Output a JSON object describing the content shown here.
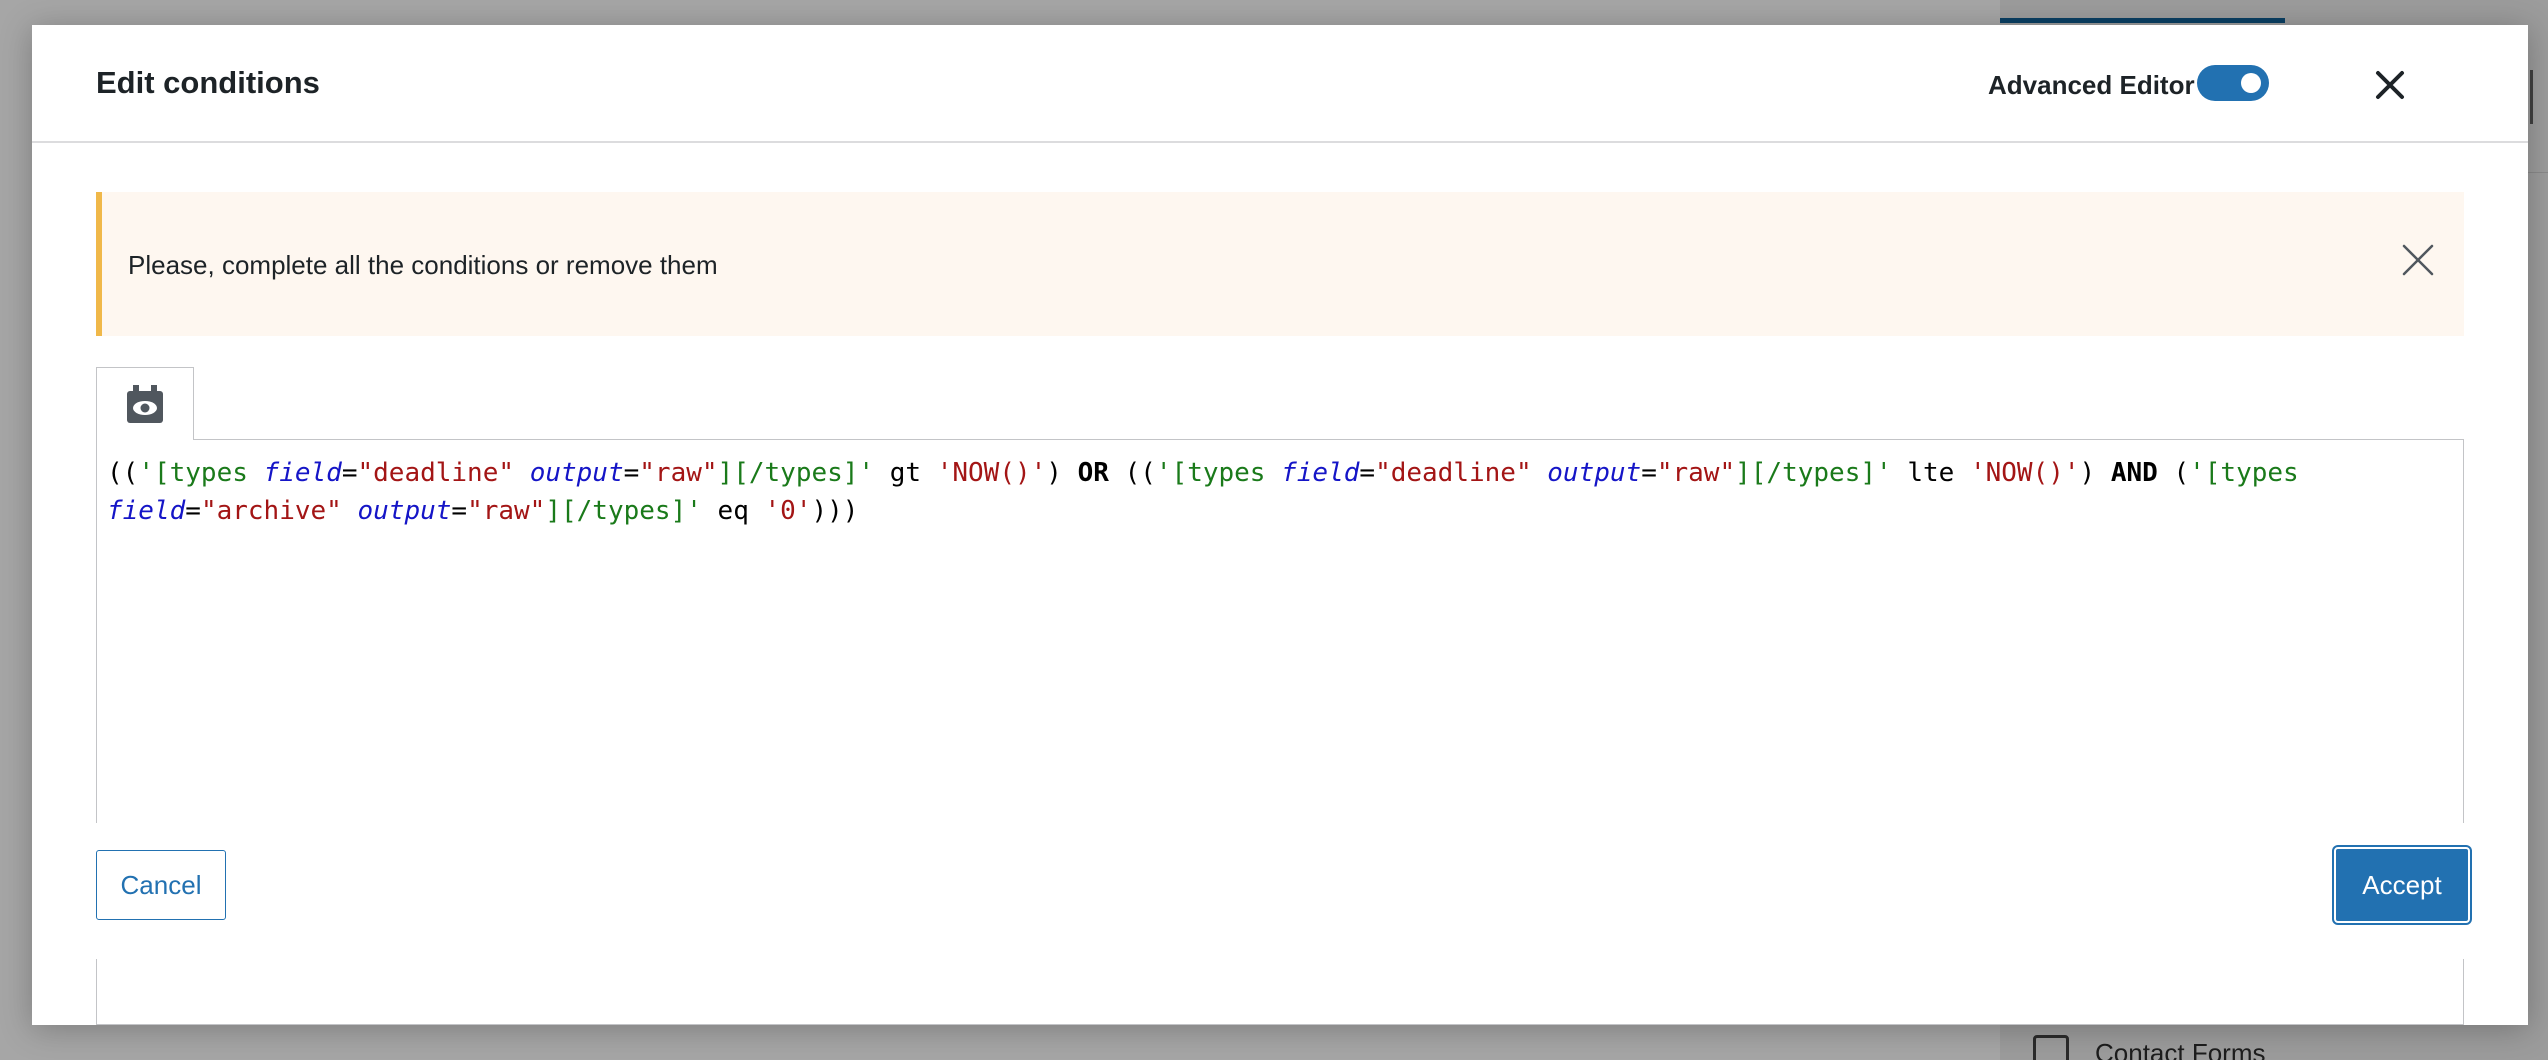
{
  "background": {
    "contact_forms_label": "Contact Forms"
  },
  "modal": {
    "title": "Edit conditions",
    "advanced_editor_label": "Advanced Editor",
    "advanced_editor_on": true,
    "close_icon": "close-icon"
  },
  "notice": {
    "text": "Please, complete all the conditions or remove them",
    "close_icon": "close-icon"
  },
  "editor": {
    "tab_icon": "preview-eye-icon",
    "code_tokens": [
      {
        "text": "((",
        "style": "plain"
      },
      {
        "text": "'[types ",
        "style": "green"
      },
      {
        "text": "field",
        "style": "attr"
      },
      {
        "text": "=",
        "style": "plain"
      },
      {
        "text": "\"deadline\"",
        "style": "red"
      },
      {
        "text": " ",
        "style": "plain"
      },
      {
        "text": "output",
        "style": "attr"
      },
      {
        "text": "=",
        "style": "plain"
      },
      {
        "text": "\"raw\"",
        "style": "red"
      },
      {
        "text": "][/types]'",
        "style": "green"
      },
      {
        "text": " gt ",
        "style": "plain"
      },
      {
        "text": "'NOW()'",
        "style": "red"
      },
      {
        "text": ") ",
        "style": "plain"
      },
      {
        "text": "OR",
        "style": "bold"
      },
      {
        "text": " ((",
        "style": "plain"
      },
      {
        "text": "'[types ",
        "style": "green"
      },
      {
        "text": "field",
        "style": "attr"
      },
      {
        "text": "=",
        "style": "plain"
      },
      {
        "text": "\"deadline\"",
        "style": "red"
      },
      {
        "text": " ",
        "style": "plain"
      },
      {
        "text": "output",
        "style": "attr"
      },
      {
        "text": "=",
        "style": "plain"
      },
      {
        "text": "\"raw\"",
        "style": "red"
      },
      {
        "text": "][/types]'",
        "style": "green"
      },
      {
        "text": " lte ",
        "style": "plain"
      },
      {
        "text": "'NOW()'",
        "style": "red"
      },
      {
        "text": ") ",
        "style": "plain"
      },
      {
        "text": "AND",
        "style": "bold"
      },
      {
        "text": " (",
        "style": "plain"
      },
      {
        "text": "'[types ",
        "style": "green"
      },
      {
        "text": "field",
        "style": "attr"
      },
      {
        "text": "=",
        "style": "plain"
      },
      {
        "text": "\"archive\"",
        "style": "red"
      },
      {
        "text": " ",
        "style": "plain"
      },
      {
        "text": "output",
        "style": "attr"
      },
      {
        "text": "=",
        "style": "plain"
      },
      {
        "text": "\"raw\"",
        "style": "red"
      },
      {
        "text": "][/types]'",
        "style": "green"
      },
      {
        "text": " eq ",
        "style": "plain"
      },
      {
        "text": "'0'",
        "style": "red"
      },
      {
        "text": ")))",
        "style": "plain"
      }
    ]
  },
  "footer": {
    "cancel_label": "Cancel",
    "accept_label": "Accept"
  },
  "colors": {
    "primary": "#2271b1",
    "notice_border": "#f0b849",
    "notice_bg": "#fef7f0"
  }
}
